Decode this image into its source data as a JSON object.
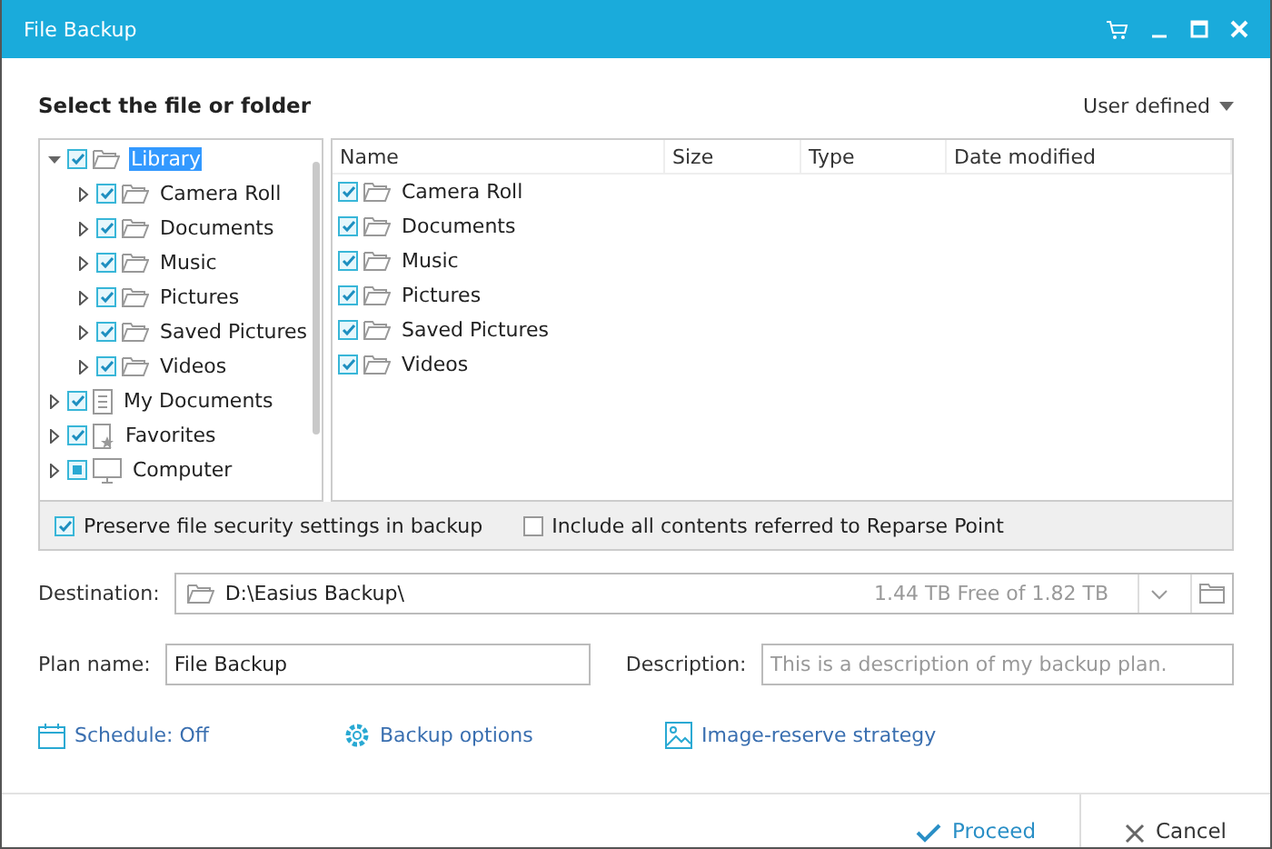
{
  "window": {
    "title": "File Backup"
  },
  "header": {
    "title": "Select the file or folder",
    "mode": "User defined"
  },
  "tree": [
    {
      "label": "Library",
      "kind": "folder",
      "checked": true,
      "partial": false,
      "expanded": true,
      "selected": true,
      "children": [
        {
          "label": "Camera Roll",
          "kind": "folder",
          "checked": true,
          "partial": false,
          "expanded": false,
          "selected": false
        },
        {
          "label": "Documents",
          "kind": "folder",
          "checked": true,
          "partial": false,
          "expanded": false,
          "selected": false
        },
        {
          "label": "Music",
          "kind": "folder",
          "checked": true,
          "partial": false,
          "expanded": false,
          "selected": false
        },
        {
          "label": "Pictures",
          "kind": "folder",
          "checked": true,
          "partial": false,
          "expanded": false,
          "selected": false
        },
        {
          "label": "Saved Pictures",
          "kind": "folder",
          "checked": true,
          "partial": false,
          "expanded": false,
          "selected": false
        },
        {
          "label": "Videos",
          "kind": "folder",
          "checked": true,
          "partial": false,
          "expanded": false,
          "selected": false
        }
      ]
    },
    {
      "label": "My Documents",
      "kind": "document",
      "checked": true,
      "partial": false,
      "expanded": false,
      "selected": false
    },
    {
      "label": "Favorites",
      "kind": "favorites",
      "checked": true,
      "partial": false,
      "expanded": false,
      "selected": false
    },
    {
      "label": "Computer",
      "kind": "computer",
      "checked": false,
      "partial": true,
      "expanded": false,
      "selected": false
    }
  ],
  "table": {
    "columns": [
      "Name",
      "Size",
      "Type",
      "Date modified"
    ],
    "rows": [
      {
        "name": "Camera Roll",
        "checked": true
      },
      {
        "name": "Documents",
        "checked": true
      },
      {
        "name": "Music",
        "checked": true
      },
      {
        "name": "Pictures",
        "checked": true
      },
      {
        "name": "Saved Pictures",
        "checked": true
      },
      {
        "name": "Videos",
        "checked": true
      }
    ]
  },
  "options": [
    {
      "label": "Preserve file security settings in backup",
      "checked": true
    },
    {
      "label": "Include all contents referred to Reparse Point",
      "checked": false
    }
  ],
  "destination": {
    "label": "Destination:",
    "value": "D:\\Easius Backup\\",
    "space": "1.44 TB Free of 1.82 TB"
  },
  "plan": {
    "label": "Plan name:",
    "value": "File Backup"
  },
  "description": {
    "label": "Description:",
    "placeholder": "This is a description of my backup plan."
  },
  "links": [
    {
      "kind": "schedule",
      "label": "Schedule: Off"
    },
    {
      "kind": "options",
      "label": "Backup options"
    },
    {
      "kind": "image",
      "label": "Image-reserve strategy"
    }
  ],
  "buttons": [
    {
      "kind": "proceed",
      "label": "Proceed"
    },
    {
      "kind": "cancel",
      "label": "Cancel"
    }
  ]
}
